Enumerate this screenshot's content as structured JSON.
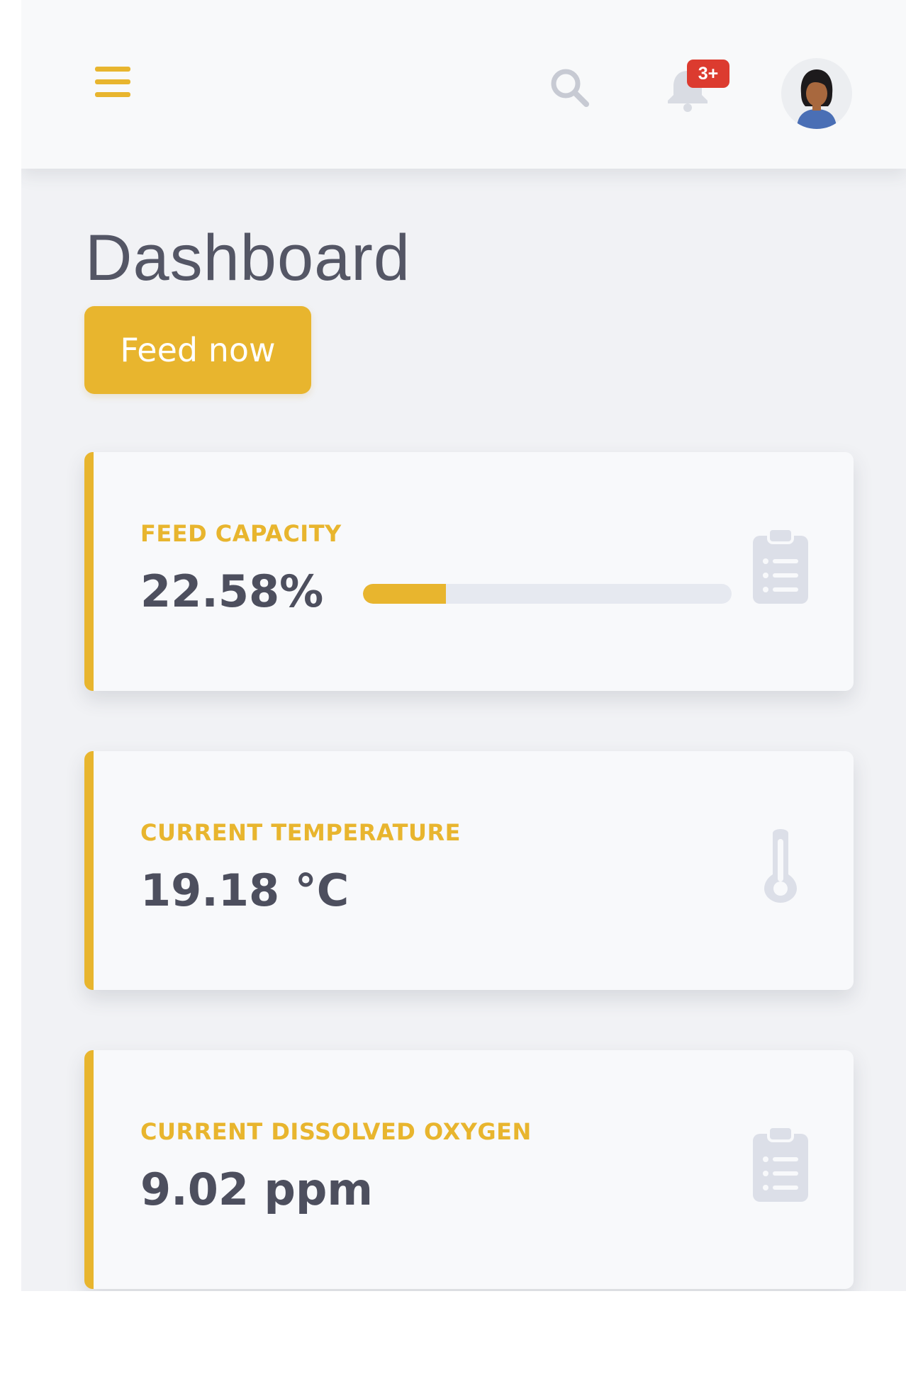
{
  "topbar": {
    "menu_icon": "hamburger-icon",
    "search_icon": "search-icon",
    "notification_icon": "bell-icon",
    "notification_badge": "3+",
    "avatar_icon": "user-avatar"
  },
  "page": {
    "title": "Dashboard",
    "feed_button_label": "Feed now"
  },
  "cards": [
    {
      "label": "FEED CAPACITY",
      "value": "22.58%",
      "progress_percent": 22.58,
      "icon": "clipboard-list-icon"
    },
    {
      "label": "CURRENT TEMPERATURE",
      "value": "19.18 °C",
      "icon": "thermometer-icon"
    },
    {
      "label": "CURRENT DISSOLVED OXYGEN",
      "value": "9.02 ppm",
      "icon": "clipboard-list-icon"
    }
  ],
  "colors": {
    "accent": "#e8b52e",
    "badge": "#dc3b2f",
    "background": "#f1f2f5",
    "card": "#f8f9fb",
    "text_dark": "#4d4f5e",
    "icon_muted": "#d9dce6"
  }
}
